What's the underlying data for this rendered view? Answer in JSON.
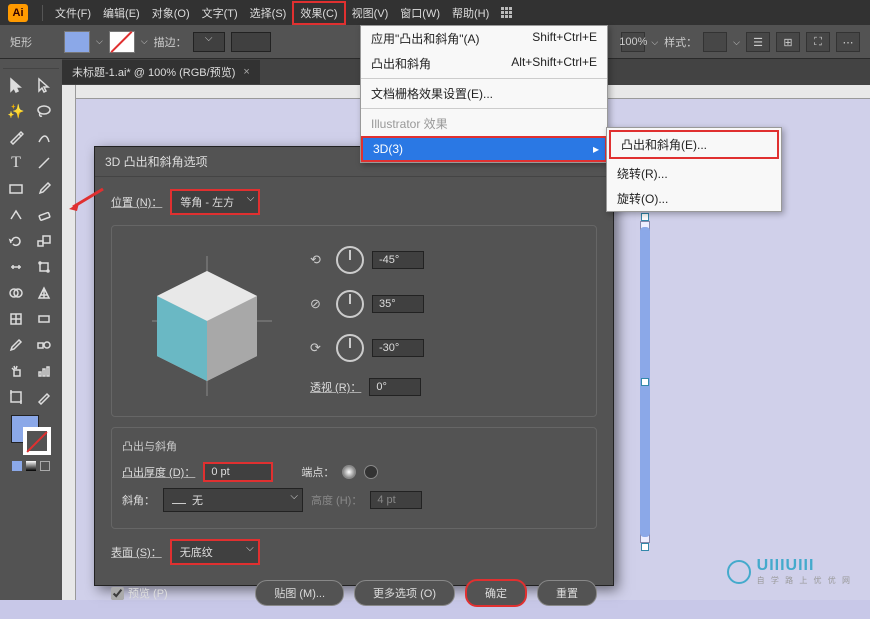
{
  "app": {
    "logo": "Ai"
  },
  "menu": [
    "文件(F)",
    "编辑(E)",
    "对象(O)",
    "文字(T)",
    "选择(S)",
    "效果(C)",
    "视图(V)",
    "窗口(W)",
    "帮助(H)"
  ],
  "optbar": {
    "shape": "矩形",
    "stroke_label": "描边：",
    "zoom": "100%",
    "style_label": "样式："
  },
  "tab": {
    "title": "未标题-1.ai* @ 100% (RGB/预览)"
  },
  "dropdown": {
    "items": [
      {
        "label": "应用\"凸出和斜角\"(A)",
        "accel": "Shift+Ctrl+E"
      },
      {
        "label": "凸出和斜角",
        "accel": "Alt+Shift+Ctrl+E"
      },
      {
        "label": "文档栅格效果设置(E)..."
      },
      {
        "section": "Illustrator 效果",
        "gray": true
      },
      {
        "label": "3D(3)",
        "selected": true
      }
    ]
  },
  "submenu": {
    "items": [
      "凸出和斜角(E)...",
      "绕转(R)...",
      "旋转(O)..."
    ]
  },
  "dialog": {
    "title": "3D 凸出和斜角选项",
    "position_label": "位置 (N)：",
    "position_value": "等角 - 左方",
    "angles": [
      "-45°",
      "35°",
      "-30°"
    ],
    "perspective_label": "透视 (R)：",
    "perspective_value": "0°",
    "extrude_section": "凸出与斜角",
    "depth_label": "凸出厚度 (D)：",
    "depth_value": "0 pt",
    "cap_label": "端点：",
    "bevel_label": "斜角：",
    "bevel_value": "无",
    "height_label": "高度 (H)：",
    "height_value": "4 pt",
    "surface_label": "表面 (S)：",
    "surface_value": "无底纹",
    "preview": "预览 (P)",
    "map": "贴图 (M)...",
    "more": "更多选项 (O)",
    "ok": "确定",
    "reset": "重置"
  },
  "footer": {
    "brand": "UIIIUIII",
    "tag": "自 学 路 上 优 优 网"
  }
}
